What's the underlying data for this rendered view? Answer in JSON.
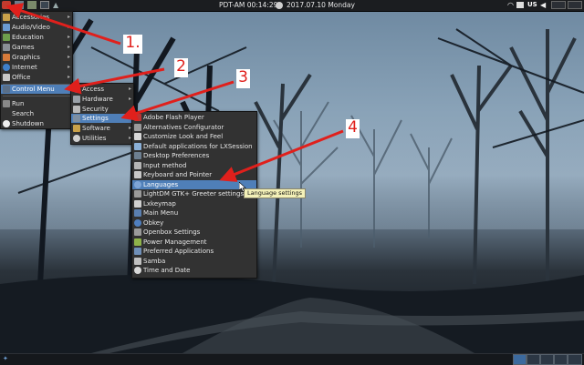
{
  "topbar": {
    "clock": "PDT-AM 00:14:29",
    "date": "2017.07.10 Monday",
    "keyboard_layout": "US"
  },
  "main_menu": {
    "items": [
      {
        "label": "Accessories",
        "icon": "accessories-icon",
        "submenu": true
      },
      {
        "label": "Audio/Video",
        "icon": "audio-video-icon",
        "submenu": true
      },
      {
        "label": "Education",
        "icon": "education-icon",
        "submenu": true
      },
      {
        "label": "Games",
        "icon": "games-icon",
        "submenu": true
      },
      {
        "label": "Graphics",
        "icon": "graphics-icon",
        "submenu": true
      },
      {
        "label": "Internet",
        "icon": "internet-icon",
        "submenu": true
      },
      {
        "label": "Office",
        "icon": "office-icon",
        "submenu": true
      },
      {
        "label": "Control Menu",
        "icon": "control-menu-icon",
        "submenu": true,
        "selected": true
      },
      {
        "label": "Run",
        "icon": "run-icon",
        "submenu": false
      },
      {
        "label": "Search",
        "icon": "search-icon",
        "submenu": false
      },
      {
        "label": "Shutdown",
        "icon": "shutdown-icon",
        "submenu": false
      }
    ]
  },
  "control_menu": {
    "items": [
      {
        "label": "Access",
        "icon": "access-icon",
        "submenu": true
      },
      {
        "label": "Hardware",
        "icon": "hardware-icon",
        "submenu": true
      },
      {
        "label": "Security",
        "icon": "security-icon",
        "submenu": false
      },
      {
        "label": "Settings",
        "icon": "settings-icon",
        "submenu": true,
        "selected": true
      },
      {
        "label": "Software",
        "icon": "software-icon",
        "submenu": true
      },
      {
        "label": "Utilities",
        "icon": "utilities-icon",
        "submenu": true
      }
    ]
  },
  "settings_menu": {
    "items": [
      {
        "label": "Adobe Flash Player",
        "icon": "flash-icon"
      },
      {
        "label": "Alternatives Configurator",
        "icon": "alternatives-icon"
      },
      {
        "label": "Customize Look and Feel",
        "icon": "appearance-icon"
      },
      {
        "label": "Default applications for LXSession",
        "icon": "default-apps-icon"
      },
      {
        "label": "Desktop Preferences",
        "icon": "desktop-icon"
      },
      {
        "label": "Input method",
        "icon": "input-method-icon"
      },
      {
        "label": "Keyboard and Pointer",
        "icon": "keyboard-icon"
      },
      {
        "label": "Languages",
        "icon": "languages-icon",
        "selected": true
      },
      {
        "label": "LightDM GTK+ Greeter settings",
        "icon": "lightdm-icon"
      },
      {
        "label": "Lxkeymap",
        "icon": "lxkeymap-icon"
      },
      {
        "label": "Main Menu",
        "icon": "main-menu-icon"
      },
      {
        "label": "Obkey",
        "icon": "obkey-icon"
      },
      {
        "label": "Openbox Settings",
        "icon": "openbox-icon"
      },
      {
        "label": "Power Management",
        "icon": "power-icon"
      },
      {
        "label": "Preferred Applications",
        "icon": "preferred-apps-icon"
      },
      {
        "label": "Samba",
        "icon": "samba-icon"
      },
      {
        "label": "Time and Date",
        "icon": "time-date-icon"
      }
    ]
  },
  "tooltip": {
    "text": "Language settings"
  },
  "callouts": [
    {
      "number": "1."
    },
    {
      "number": "2"
    },
    {
      "number": "3"
    },
    {
      "number": "4"
    }
  ],
  "colors": {
    "menu_bg": "#323232",
    "selection": "#4f7fb8",
    "arrow": "#e0201c",
    "tooltip_bg": "#f4f1b8"
  }
}
